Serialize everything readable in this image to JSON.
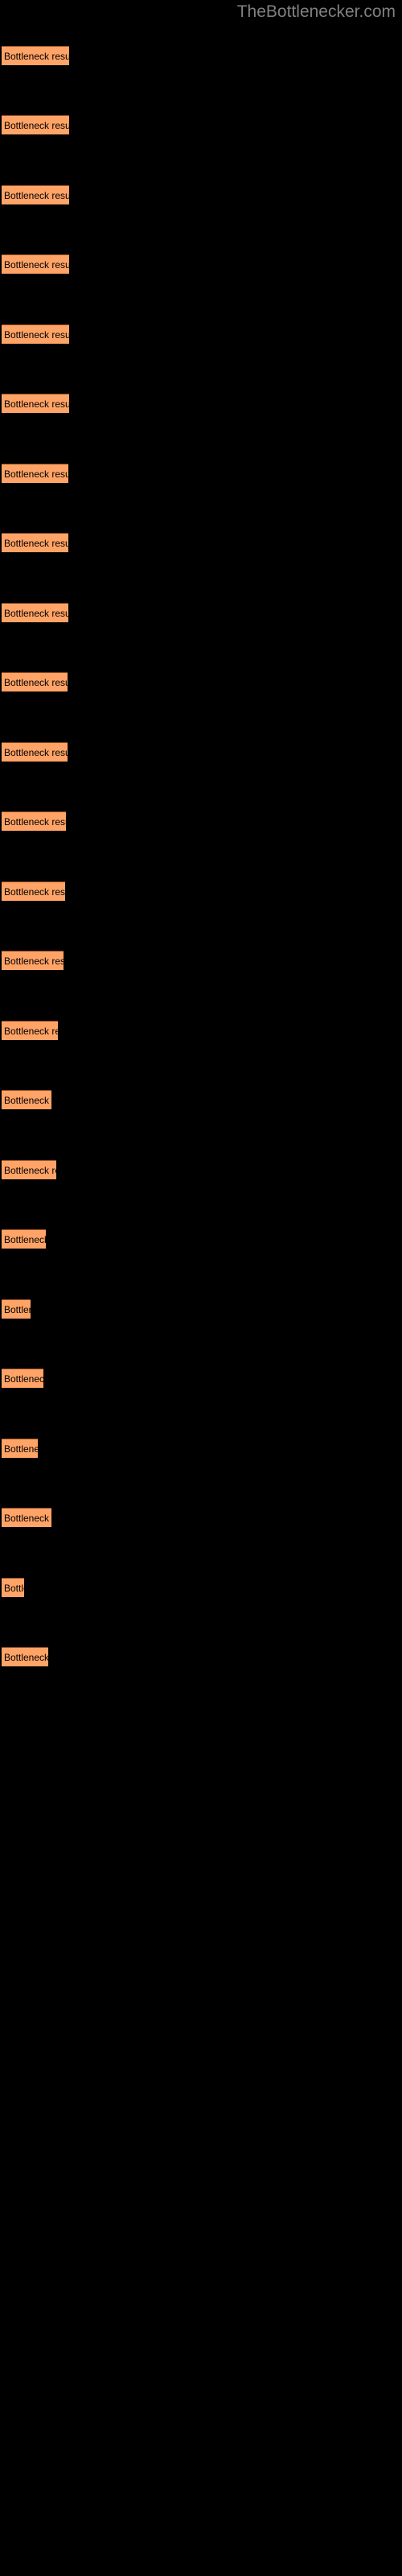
{
  "site": {
    "title": "TheBottlenecker.com",
    "title_color": "#808080",
    "background_color": "#000000"
  },
  "chart_data": {
    "type": "bar",
    "orientation": "horizontal",
    "title": "TheBottlenecker.com",
    "xlabel": "",
    "ylabel": "",
    "grid": false,
    "legend": false,
    "bar_color": "#FFA366",
    "bar_border_color": "#8A4A22",
    "label_color": "#000000",
    "xlim": [
      0,
      100
    ],
    "categories": [
      "Bottleneck result",
      "Bottleneck result",
      "Bottleneck result",
      "Bottleneck result",
      "Bottleneck result",
      "Bottleneck result",
      "Bottleneck result",
      "Bottleneck result",
      "Bottleneck result",
      "Bottleneck result",
      "Bottleneck result",
      "Bottleneck result",
      "Bottleneck result",
      "Bottleneck result",
      "Bottleneck result",
      "Bottleneck result",
      "Bottleneck result",
      "Bottleneck result",
      "Bottleneck result",
      "Bottleneck result",
      "Bottleneck result",
      "Bottleneck result",
      "Bottleneck result",
      "Bottleneck result"
    ],
    "values": [
      84,
      84,
      84,
      84,
      84,
      84,
      83,
      83,
      83,
      82,
      82,
      80,
      79,
      77,
      70,
      62,
      68,
      55,
      40,
      52,
      47,
      60,
      30,
      58
    ],
    "bars": [
      {
        "label": "Bottleneck result",
        "value": 84,
        "y": 57,
        "width": 84
      },
      {
        "label": "Bottleneck result",
        "value": 84,
        "y": 143,
        "width": 84
      },
      {
        "label": "Bottleneck result",
        "value": 84,
        "y": 230,
        "width": 84
      },
      {
        "label": "Bottleneck result",
        "value": 84,
        "y": 316,
        "width": 84
      },
      {
        "label": "Bottleneck result",
        "value": 84,
        "y": 403,
        "width": 84
      },
      {
        "label": "Bottleneck result",
        "value": 84,
        "y": 489,
        "width": 84
      },
      {
        "label": "Bottleneck result",
        "value": 83,
        "y": 576,
        "width": 83
      },
      {
        "label": "Bottleneck result",
        "value": 83,
        "y": 662,
        "width": 83
      },
      {
        "label": "Bottleneck result",
        "value": 83,
        "y": 749,
        "width": 83
      },
      {
        "label": "Bottleneck result",
        "value": 82,
        "y": 835,
        "width": 82
      },
      {
        "label": "Bottleneck result",
        "value": 82,
        "y": 922,
        "width": 82
      },
      {
        "label": "Bottleneck result",
        "value": 80,
        "y": 1008,
        "width": 80
      },
      {
        "label": "Bottleneck result",
        "value": 79,
        "y": 1095,
        "width": 79
      },
      {
        "label": "Bottleneck result",
        "value": 77,
        "y": 1181,
        "width": 77
      },
      {
        "label": "Bottleneck result",
        "value": 70,
        "y": 1268,
        "width": 70
      },
      {
        "label": "Bottleneck result",
        "value": 62,
        "y": 1354,
        "width": 62
      },
      {
        "label": "Bottleneck result",
        "value": 68,
        "y": 1441,
        "width": 68
      },
      {
        "label": "Bottleneck result",
        "value": 55,
        "y": 1527,
        "width": 55
      },
      {
        "label": "Bottleneck result",
        "value": 36,
        "y": 1614,
        "width": 36
      },
      {
        "label": "Bottleneck result",
        "value": 52,
        "y": 1700,
        "width": 52
      },
      {
        "label": "Bottleneck result",
        "value": 45,
        "y": 1787,
        "width": 45
      },
      {
        "label": "Bottleneck result",
        "value": 62,
        "y": 1873,
        "width": 62
      },
      {
        "label": "Bottleneck result",
        "value": 28,
        "y": 1960,
        "width": 28
      },
      {
        "label": "Bottleneck result",
        "value": 58,
        "y": 2046,
        "width": 58
      }
    ]
  }
}
